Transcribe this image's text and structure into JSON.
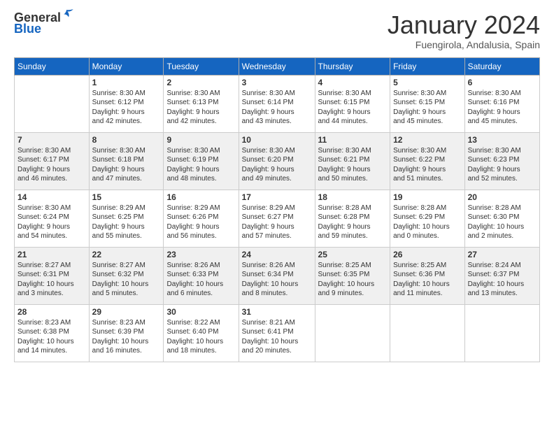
{
  "logo": {
    "general": "General",
    "blue": "Blue"
  },
  "header": {
    "month": "January 2024",
    "location": "Fuengirola, Andalusia, Spain"
  },
  "weekdays": [
    "Sunday",
    "Monday",
    "Tuesday",
    "Wednesday",
    "Thursday",
    "Friday",
    "Saturday"
  ],
  "weeks": [
    [
      {
        "day": "",
        "info": ""
      },
      {
        "day": "1",
        "info": "Sunrise: 8:30 AM\nSunset: 6:12 PM\nDaylight: 9 hours\nand 42 minutes."
      },
      {
        "day": "2",
        "info": "Sunrise: 8:30 AM\nSunset: 6:13 PM\nDaylight: 9 hours\nand 42 minutes."
      },
      {
        "day": "3",
        "info": "Sunrise: 8:30 AM\nSunset: 6:14 PM\nDaylight: 9 hours\nand 43 minutes."
      },
      {
        "day": "4",
        "info": "Sunrise: 8:30 AM\nSunset: 6:15 PM\nDaylight: 9 hours\nand 44 minutes."
      },
      {
        "day": "5",
        "info": "Sunrise: 8:30 AM\nSunset: 6:15 PM\nDaylight: 9 hours\nand 45 minutes."
      },
      {
        "day": "6",
        "info": "Sunrise: 8:30 AM\nSunset: 6:16 PM\nDaylight: 9 hours\nand 45 minutes."
      }
    ],
    [
      {
        "day": "7",
        "info": "Sunrise: 8:30 AM\nSunset: 6:17 PM\nDaylight: 9 hours\nand 46 minutes."
      },
      {
        "day": "8",
        "info": "Sunrise: 8:30 AM\nSunset: 6:18 PM\nDaylight: 9 hours\nand 47 minutes."
      },
      {
        "day": "9",
        "info": "Sunrise: 8:30 AM\nSunset: 6:19 PM\nDaylight: 9 hours\nand 48 minutes."
      },
      {
        "day": "10",
        "info": "Sunrise: 8:30 AM\nSunset: 6:20 PM\nDaylight: 9 hours\nand 49 minutes."
      },
      {
        "day": "11",
        "info": "Sunrise: 8:30 AM\nSunset: 6:21 PM\nDaylight: 9 hours\nand 50 minutes."
      },
      {
        "day": "12",
        "info": "Sunrise: 8:30 AM\nSunset: 6:22 PM\nDaylight: 9 hours\nand 51 minutes."
      },
      {
        "day": "13",
        "info": "Sunrise: 8:30 AM\nSunset: 6:23 PM\nDaylight: 9 hours\nand 52 minutes."
      }
    ],
    [
      {
        "day": "14",
        "info": "Sunrise: 8:30 AM\nSunset: 6:24 PM\nDaylight: 9 hours\nand 54 minutes."
      },
      {
        "day": "15",
        "info": "Sunrise: 8:29 AM\nSunset: 6:25 PM\nDaylight: 9 hours\nand 55 minutes."
      },
      {
        "day": "16",
        "info": "Sunrise: 8:29 AM\nSunset: 6:26 PM\nDaylight: 9 hours\nand 56 minutes."
      },
      {
        "day": "17",
        "info": "Sunrise: 8:29 AM\nSunset: 6:27 PM\nDaylight: 9 hours\nand 57 minutes."
      },
      {
        "day": "18",
        "info": "Sunrise: 8:28 AM\nSunset: 6:28 PM\nDaylight: 9 hours\nand 59 minutes."
      },
      {
        "day": "19",
        "info": "Sunrise: 8:28 AM\nSunset: 6:29 PM\nDaylight: 10 hours\nand 0 minutes."
      },
      {
        "day": "20",
        "info": "Sunrise: 8:28 AM\nSunset: 6:30 PM\nDaylight: 10 hours\nand 2 minutes."
      }
    ],
    [
      {
        "day": "21",
        "info": "Sunrise: 8:27 AM\nSunset: 6:31 PM\nDaylight: 10 hours\nand 3 minutes."
      },
      {
        "day": "22",
        "info": "Sunrise: 8:27 AM\nSunset: 6:32 PM\nDaylight: 10 hours\nand 5 minutes."
      },
      {
        "day": "23",
        "info": "Sunrise: 8:26 AM\nSunset: 6:33 PM\nDaylight: 10 hours\nand 6 minutes."
      },
      {
        "day": "24",
        "info": "Sunrise: 8:26 AM\nSunset: 6:34 PM\nDaylight: 10 hours\nand 8 minutes."
      },
      {
        "day": "25",
        "info": "Sunrise: 8:25 AM\nSunset: 6:35 PM\nDaylight: 10 hours\nand 9 minutes."
      },
      {
        "day": "26",
        "info": "Sunrise: 8:25 AM\nSunset: 6:36 PM\nDaylight: 10 hours\nand 11 minutes."
      },
      {
        "day": "27",
        "info": "Sunrise: 8:24 AM\nSunset: 6:37 PM\nDaylight: 10 hours\nand 13 minutes."
      }
    ],
    [
      {
        "day": "28",
        "info": "Sunrise: 8:23 AM\nSunset: 6:38 PM\nDaylight: 10 hours\nand 14 minutes."
      },
      {
        "day": "29",
        "info": "Sunrise: 8:23 AM\nSunset: 6:39 PM\nDaylight: 10 hours\nand 16 minutes."
      },
      {
        "day": "30",
        "info": "Sunrise: 8:22 AM\nSunset: 6:40 PM\nDaylight: 10 hours\nand 18 minutes."
      },
      {
        "day": "31",
        "info": "Sunrise: 8:21 AM\nSunset: 6:41 PM\nDaylight: 10 hours\nand 20 minutes."
      },
      {
        "day": "",
        "info": ""
      },
      {
        "day": "",
        "info": ""
      },
      {
        "day": "",
        "info": ""
      }
    ]
  ]
}
